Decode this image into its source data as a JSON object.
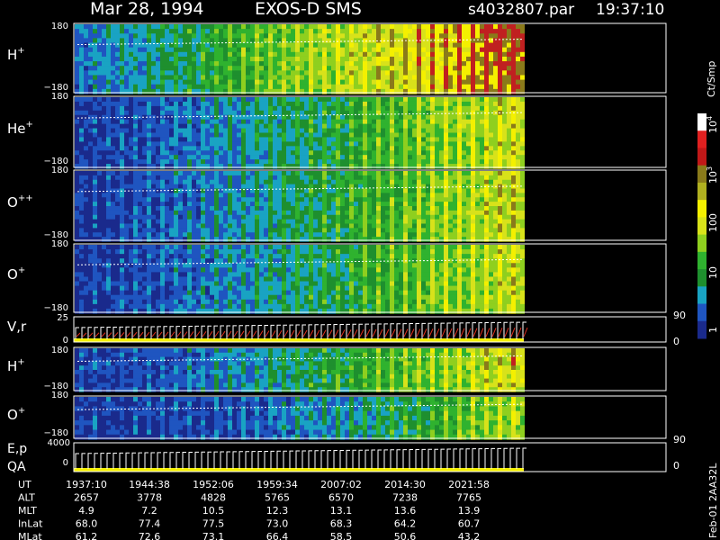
{
  "header": {
    "date": "Mar 28, 1994",
    "instrument": "EXOS-D SMS",
    "file": "s4032807.par",
    "time": "19:37:10"
  },
  "panels": [
    {
      "label": "H",
      "sup": "+",
      "ymax": "180",
      "ymin": "−180"
    },
    {
      "label": "He",
      "sup": "+",
      "ymax": "180",
      "ymin": "−180"
    },
    {
      "label": "O",
      "sup": "++",
      "ymax": "180",
      "ymin": "−180"
    },
    {
      "label": "O",
      "sup": "+",
      "ymax": "180",
      "ymin": "−180"
    },
    {
      "label": "V,r",
      "sup": "",
      "ymax": "25",
      "ymin": "0",
      "rmax": "90",
      "rmin": "0"
    },
    {
      "label": "H",
      "sup": "+",
      "ymax": "180",
      "ymin": "−180"
    },
    {
      "label": "O",
      "sup": "+",
      "ymax": "180",
      "ymin": "−180"
    },
    {
      "label": "E,p",
      "label2": "QA",
      "ymax": "4000",
      "ymin": "0",
      "rmax": "90",
      "rmin": "0"
    }
  ],
  "colorbar": {
    "unit": "Ct/Smp",
    "base": "10",
    "exp_hi": "4",
    "exp_mid": "3",
    "tick_100": "100",
    "tick_10": "10",
    "tick_1": "1"
  },
  "footer": {
    "rows": [
      {
        "label": "UT",
        "values": [
          "1937:10",
          "1944:38",
          "1952:06",
          "1959:34",
          "2007:02",
          "2014:30",
          "2021:58"
        ]
      },
      {
        "label": "ALT",
        "values": [
          "2657",
          "3778",
          "4828",
          "5765",
          "6570",
          "7238",
          "7765"
        ]
      },
      {
        "label": "MLT",
        "values": [
          "4.9",
          "7.2",
          "10.5",
          "12.3",
          "13.1",
          "13.6",
          "13.9"
        ]
      },
      {
        "label": "InLat",
        "values": [
          "68.0",
          "77.4",
          "77.5",
          "73.0",
          "68.3",
          "64.2",
          "60.7"
        ]
      },
      {
        "label": "MLat",
        "values": [
          "61.2",
          "72.6",
          "73.1",
          "66.4",
          "58.5",
          "50.6",
          "43.2"
        ]
      }
    ],
    "stamp": "Feb-01 2AA32L"
  },
  "chart_data": {
    "type": "heatmap",
    "x": [
      "1937:10",
      "1944:38",
      "1952:06",
      "1959:34",
      "2007:02",
      "2014:30",
      "2021:58"
    ],
    "ylim": [
      -180,
      180
    ],
    "colorbar_range": [
      1,
      10000
    ],
    "colorbar_scale": "log",
    "colors": {
      "background": "#000000",
      "scale": [
        "#1a2a8c",
        "#1f55c0",
        "#19a3c3",
        "#1e8f2e",
        "#2fb22f",
        "#8fcf1f",
        "#d8e21a",
        "#f4f000",
        "#8a7a1a",
        "#c02020",
        "#ffffff"
      ]
    }
  }
}
